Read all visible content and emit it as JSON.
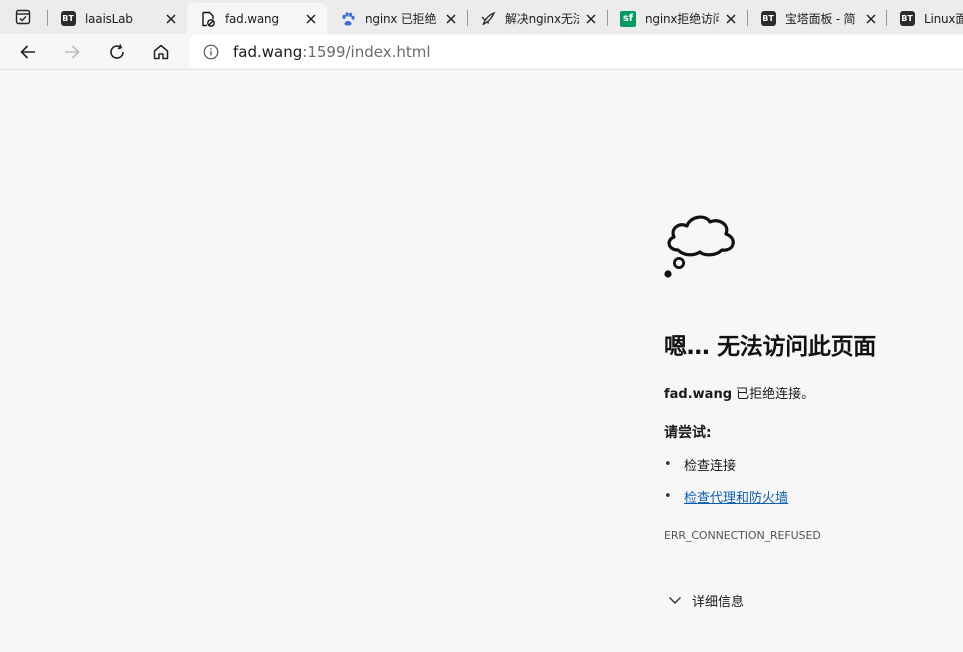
{
  "tabs": [
    {
      "title": "laaisLab",
      "favicon": "bt-icon",
      "badge": "BT",
      "active": false
    },
    {
      "title": "fad.wang",
      "favicon": "broken-page-icon",
      "badge": "",
      "active": true
    },
    {
      "title": "nginx 已拒绝",
      "favicon": "baidu-paw-icon",
      "badge": "",
      "active": false
    },
    {
      "title": "解决nginx无法",
      "favicon": "feather-icon",
      "badge": "",
      "active": false
    },
    {
      "title": "nginx拒绝访问",
      "favicon": "sf-icon",
      "badge": "sf",
      "active": false
    },
    {
      "title": "宝塔面板 - 简",
      "favicon": "bt-icon",
      "badge": "BT",
      "active": false
    },
    {
      "title": "Linux面板",
      "favicon": "bt-icon",
      "badge": "BT",
      "active": false
    }
  ],
  "address": {
    "host": "fad.wang",
    "rest": ":1599/index.html"
  },
  "error": {
    "title": "嗯… 无法访问此页面",
    "host": "fad.wang",
    "message": " 已拒绝连接。",
    "try_heading": "请尝试:",
    "suggestions": [
      {
        "text": "检查连接",
        "link": false
      },
      {
        "text": "检查代理和防火墙",
        "link": true
      }
    ],
    "bullet": "•",
    "code": "ERR_CONNECTION_REFUSED",
    "details_label": "详细信息"
  },
  "colors": {
    "page_bg": "#f7f7f7",
    "tabstrip_bg": "#ececec",
    "link": "#0b5eb4",
    "sf_green": "#009a61"
  }
}
